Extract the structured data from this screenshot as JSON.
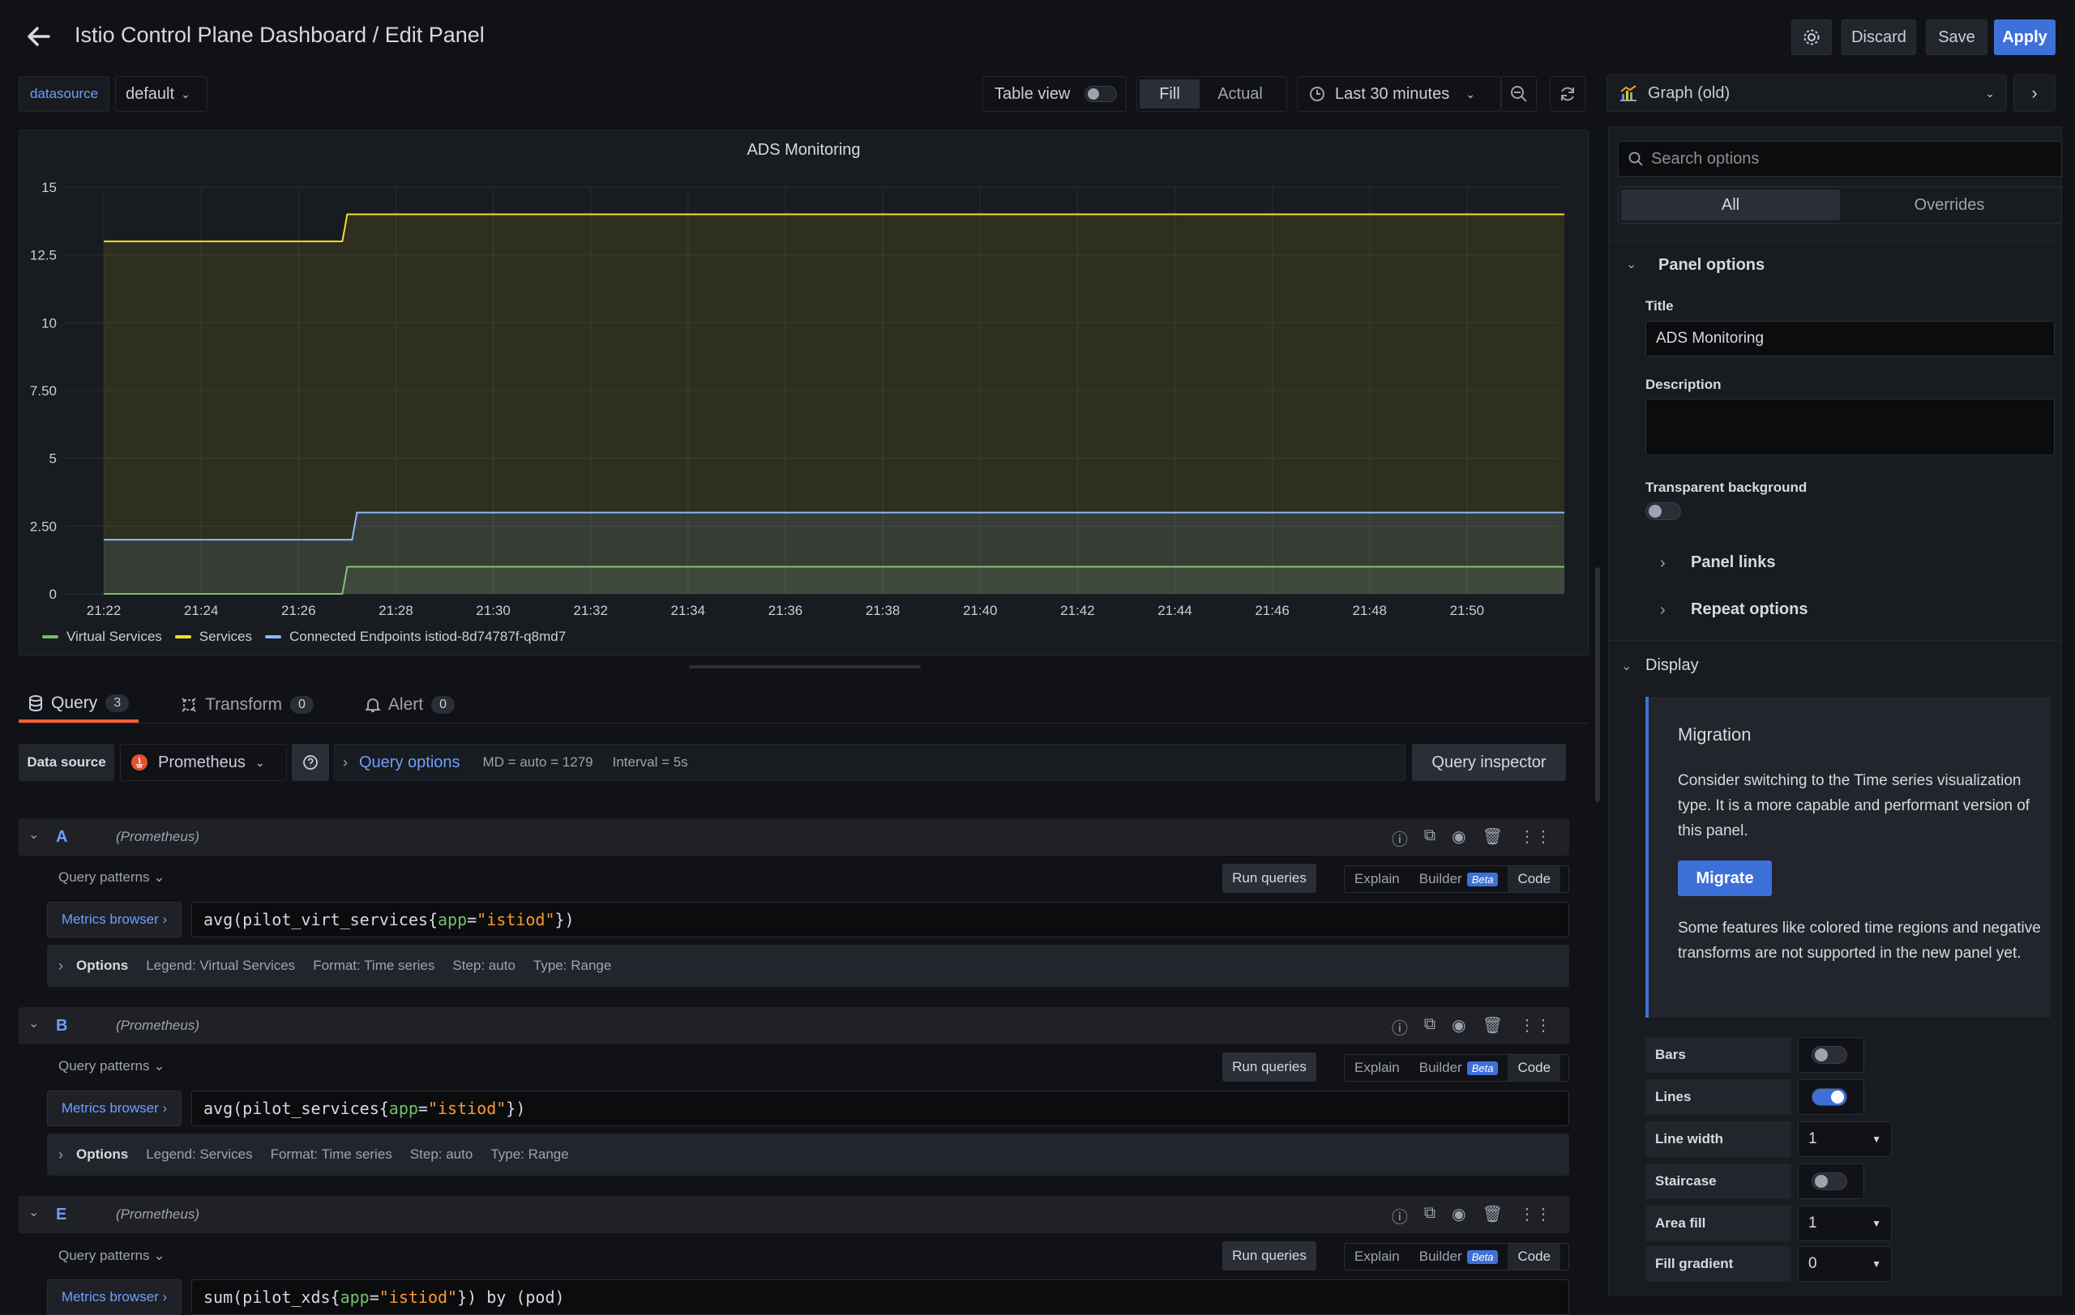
{
  "header": {
    "title": "Istio Control Plane Dashboard / Edit Panel",
    "discard": "Discard",
    "save": "Save",
    "apply": "Apply"
  },
  "toolbar": {
    "datasource_var": "datasource",
    "datasource_value": "default",
    "table_view": "Table view",
    "fill": "Fill",
    "actual": "Actual",
    "time_range": "Last 30 minutes"
  },
  "viz_picker": {
    "value": "Graph (old)"
  },
  "chart_data": {
    "type": "line",
    "title": "ADS Monitoring",
    "x": [
      "21:22",
      "21:24",
      "21:26",
      "21:28",
      "21:30",
      "21:32",
      "21:34",
      "21:36",
      "21:38",
      "21:40",
      "21:42",
      "21:44",
      "21:46",
      "21:48",
      "21:50"
    ],
    "ylim": [
      0,
      15
    ],
    "yticks": [
      "0",
      "2.50",
      "5",
      "7.50",
      "10",
      "12.5",
      "15"
    ],
    "grid": true,
    "legend_position": "bottom-left",
    "series": [
      {
        "name": "Virtual Services",
        "color": "#73bf69",
        "steps": [
          [
            21.22,
            0
          ],
          [
            21.27,
            1
          ],
          [
            21.52,
            1
          ]
        ]
      },
      {
        "name": "Services",
        "color": "#fade2a",
        "steps": [
          [
            21.22,
            13
          ],
          [
            21.27,
            14
          ],
          [
            21.52,
            14
          ]
        ]
      },
      {
        "name": "Connected Endpoints istiod-8d74787f-q8md7",
        "color": "#8ab8ff",
        "steps": [
          [
            21.22,
            2
          ],
          [
            21.272,
            3
          ],
          [
            21.52,
            3
          ]
        ]
      }
    ]
  },
  "query_tabs": [
    {
      "label": "Query",
      "count": "3"
    },
    {
      "label": "Transform",
      "count": "0"
    },
    {
      "label": "Alert",
      "count": "0"
    }
  ],
  "datasource_bar": {
    "label": "Data source",
    "value": "Prometheus",
    "query_options": "Query options",
    "md": "MD = auto = 1279",
    "interval": "Interval = 5s",
    "inspector": "Query inspector"
  },
  "queries": [
    {
      "letter": "A",
      "ds": "(Prometheus)",
      "patterns": "Query patterns",
      "run": "Run queries",
      "explain": "Explain",
      "builder": "Builder",
      "beta": "Beta",
      "code": "Code",
      "metrics_browser": "Metrics browser",
      "expr_fn": "avg(pilot_virt_services{",
      "expr_key": "app",
      "expr_eq": "=",
      "expr_val": "\"istiod\"",
      "expr_end": "})",
      "options": "Options",
      "legend": "Legend: Virtual Services",
      "format": "Format: Time series",
      "step": "Step: auto",
      "type": "Type: Range"
    },
    {
      "letter": "B",
      "ds": "(Prometheus)",
      "patterns": "Query patterns",
      "run": "Run queries",
      "explain": "Explain",
      "builder": "Builder",
      "beta": "Beta",
      "code": "Code",
      "metrics_browser": "Metrics browser",
      "expr_fn": "avg(pilot_services{",
      "expr_key": "app",
      "expr_eq": "=",
      "expr_val": "\"istiod\"",
      "expr_end": "})",
      "options": "Options",
      "legend": "Legend: Services",
      "format": "Format: Time series",
      "step": "Step: auto",
      "type": "Type: Range"
    },
    {
      "letter": "E",
      "ds": "(Prometheus)",
      "patterns": "Query patterns",
      "run": "Run queries",
      "explain": "Explain",
      "builder": "Builder",
      "beta": "Beta",
      "code": "Code",
      "metrics_browser": "Metrics browser",
      "expr_fn": "sum(pilot_xds{",
      "expr_key": "app",
      "expr_eq": "=",
      "expr_val": "\"istiod\"",
      "expr_end": "}) by (pod)"
    }
  ],
  "options_pane": {
    "search_placeholder": "Search options",
    "tab_all": "All",
    "tab_overrides": "Overrides",
    "panel_options": "Panel options",
    "title_label": "Title",
    "title_value": "ADS Monitoring",
    "description_label": "Description",
    "transparent_label": "Transparent background",
    "panel_links": "Panel links",
    "repeat_options": "Repeat options",
    "display": "Display",
    "migration_title": "Migration",
    "migration_text": "Consider switching to the Time series visualization type. It is a more capable and performant version of this panel.",
    "migrate_button": "Migrate",
    "migration_note": "Some features like colored time regions and negative transforms are not supported in the new panel yet.",
    "bars": "Bars",
    "lines": "Lines",
    "line_width": "Line width",
    "line_width_value": "1",
    "staircase": "Staircase",
    "area_fill": "Area fill",
    "area_fill_value": "1",
    "fill_gradient": "Fill gradient",
    "fill_gradient_value": "0"
  }
}
